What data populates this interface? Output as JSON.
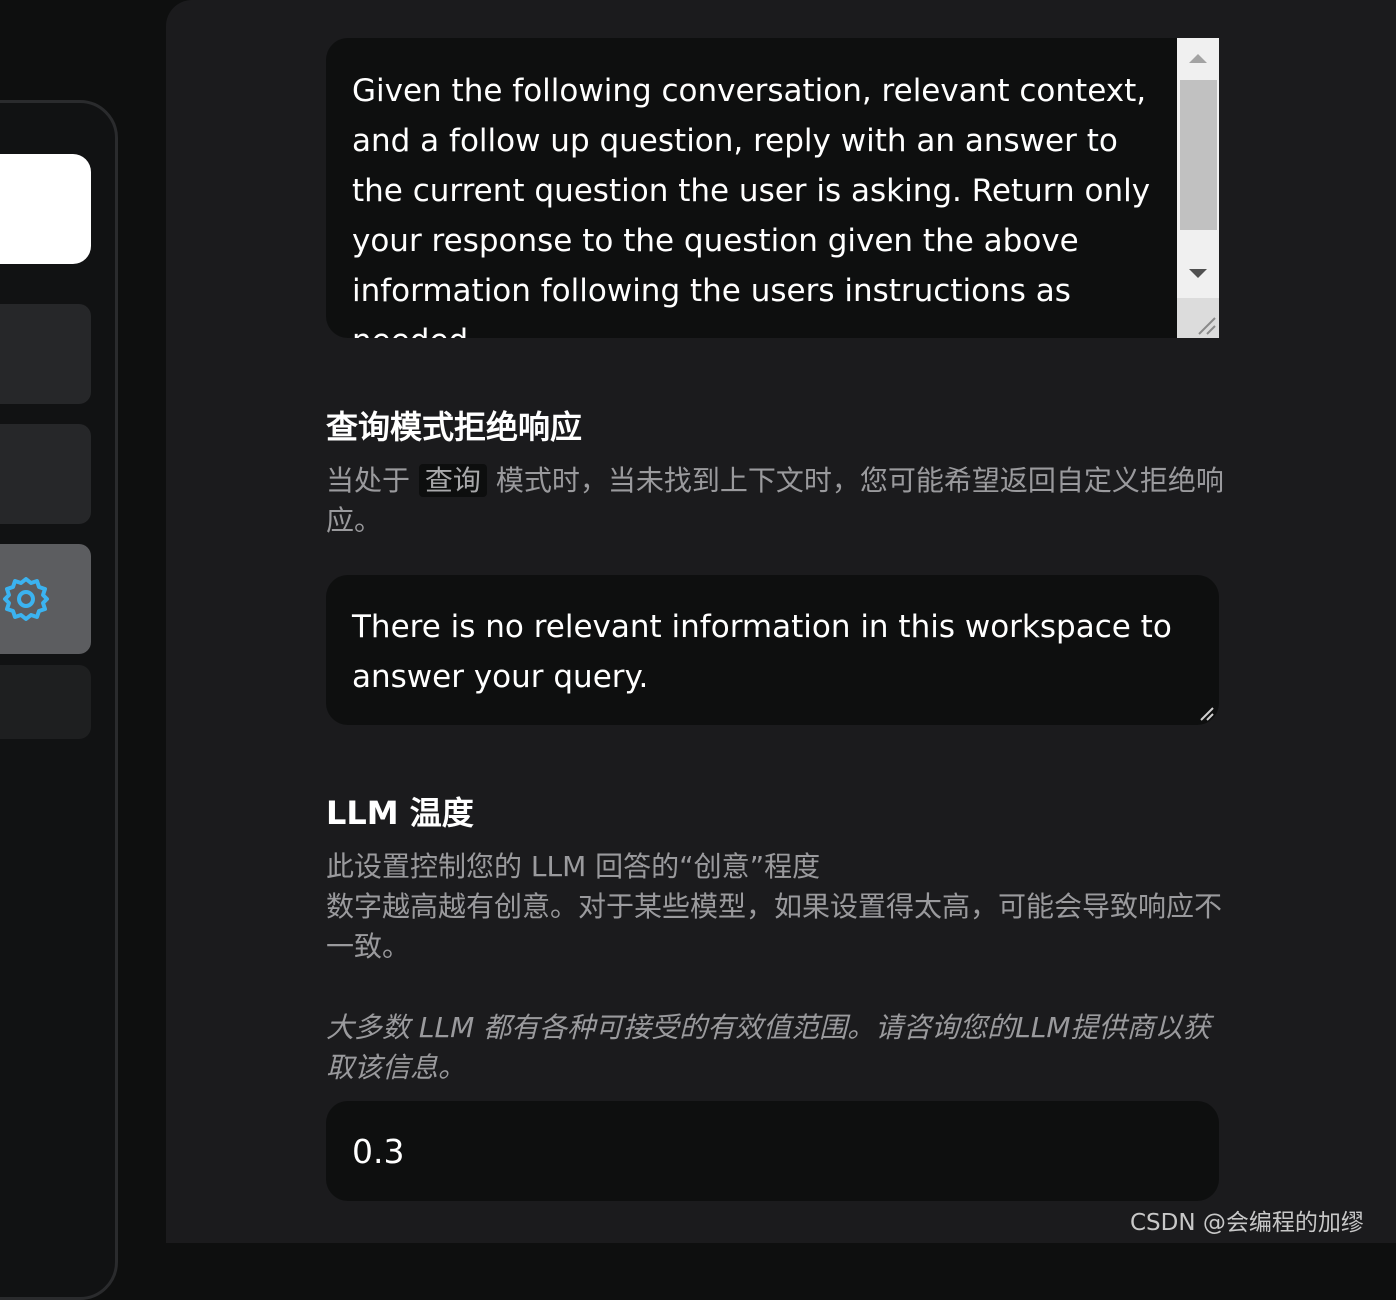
{
  "sidebar": {
    "active_icon": "gear-icon",
    "accent": "#3bb3f0"
  },
  "chat_prompt": {
    "value": "Given the following conversation, relevant context, and a follow up question, reply with an answer to the current question the user is asking. Return only your response to the question given the above information following the users instructions as needed."
  },
  "query_refusal": {
    "title": "查询模式拒绝响应",
    "desc_prefix": "当处于",
    "desc_code": "查询",
    "desc_suffix": "模式时，当未找到上下文时，您可能希望返回自定义拒绝响应。",
    "value": "There is no relevant information in this workspace to answer your query."
  },
  "llm_temperature": {
    "title": "LLM 温度",
    "desc_line1": "此设置控制您的 LLM 回答的“创意”程度",
    "desc_line2": "数字越高越有创意。对于某些模型，如果设置得太高，可能会导致响应不一致。",
    "note": "大多数 LLM 都有各种可接受的有效值范围。请咨询您的LLM提供商以获取该信息。",
    "value": "0.3"
  },
  "watermark": "CSDN @会编程的加缪"
}
